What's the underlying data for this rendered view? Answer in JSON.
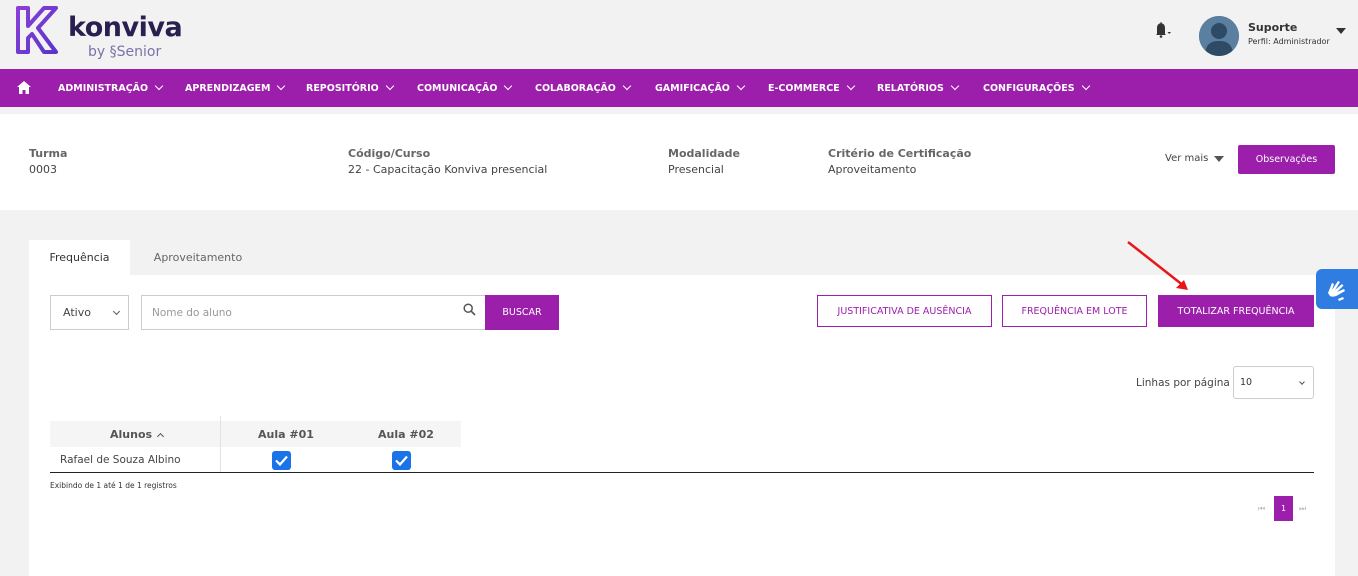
{
  "brand": {
    "name": "konviva",
    "by": "by",
    "company": "Senior",
    "accent": "#9b1fab"
  },
  "user": {
    "name": "Suporte",
    "role": "Perfil: Administrador"
  },
  "nav": {
    "items": [
      {
        "label": "ADMINISTRAÇÃO"
      },
      {
        "label": "APRENDIZAGEM"
      },
      {
        "label": "REPOSITÓRIO"
      },
      {
        "label": "COMUNICAÇÃO"
      },
      {
        "label": "COLABORAÇÃO"
      },
      {
        "label": "GAMIFICAÇÃO"
      },
      {
        "label": "E-COMMERCE"
      },
      {
        "label": "RELATÓRIOS"
      },
      {
        "label": "CONFIGURAÇÕES"
      }
    ]
  },
  "info": {
    "turma": {
      "label": "Turma",
      "value": "0003"
    },
    "curso": {
      "label": "Código/Curso",
      "value": "22 - Capacitação Konviva presencial"
    },
    "modalidade": {
      "label": "Modalidade",
      "value": "Presencial"
    },
    "criterio": {
      "label": "Critério de Certificação",
      "value": "Aproveitamento"
    },
    "ver_mais": "Ver mais",
    "observacoes": "Observações"
  },
  "tabs": [
    {
      "label": "Frequência",
      "active": true
    },
    {
      "label": "Aproveitamento",
      "active": false
    }
  ],
  "filters": {
    "status_value": "Ativo",
    "search_placeholder": "Nome do aluno",
    "search_button": "BUSCAR"
  },
  "actions": {
    "justificativa": "JUSTIFICATIVA DE AUSÊNCIA",
    "lote": "FREQUÊNCIA EM LOTE",
    "totalizar": "TOTALIZAR FREQUÊNCIA"
  },
  "pagination": {
    "rows_label": "Linhas por página",
    "rows_value": "10",
    "current_page": "1",
    "first": "⏮",
    "last": "⏭"
  },
  "table": {
    "headers": [
      "Alunos",
      "Aula #01",
      "Aula #02"
    ],
    "rows": [
      {
        "name": "Rafael de Souza Albino",
        "aula01": true,
        "aula02": true
      }
    ],
    "info": "Exibindo de 1 até 1 de 1 registros"
  },
  "icons": {
    "home": "home-icon",
    "bell": "bell-icon",
    "search": "search-icon",
    "accessibility": "sign-language-icon"
  }
}
